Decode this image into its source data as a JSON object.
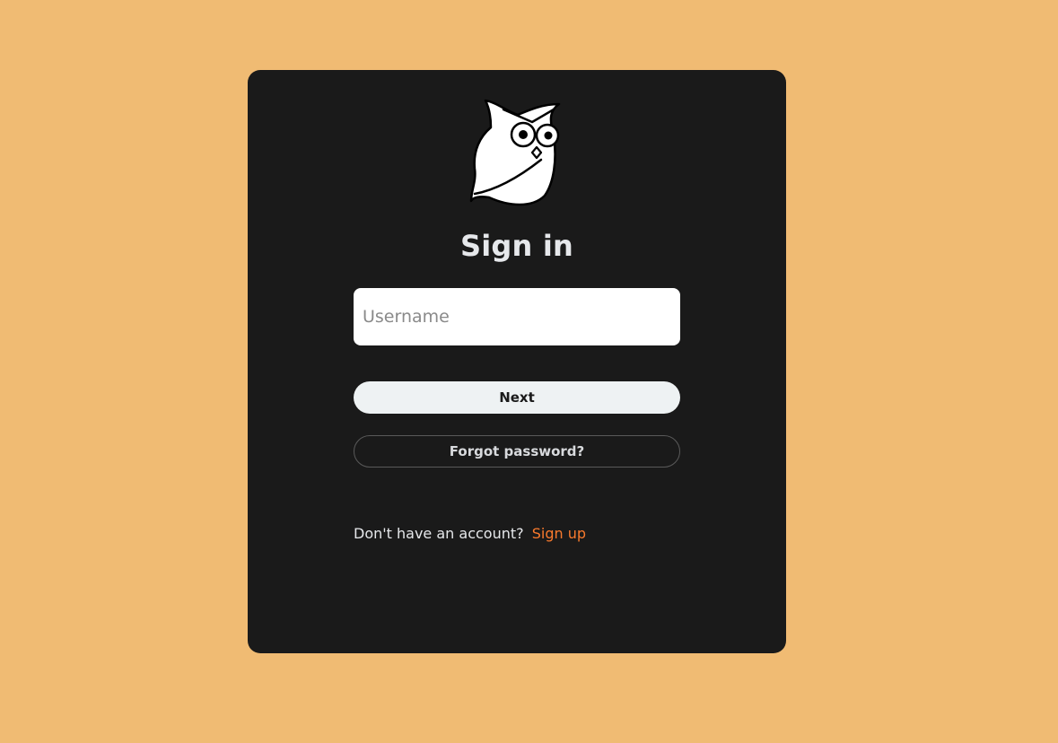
{
  "colors": {
    "background": "#F0BB73",
    "card": "#1A1A1A",
    "accent": "#F97A2D",
    "next_button": "#EEF2F3"
  },
  "logo": {
    "icon": "owl-logo-icon"
  },
  "signin": {
    "title": "Sign in",
    "username_placeholder": "Username",
    "username_value": "",
    "next_label": "Next",
    "forgot_label": "Forgot password?",
    "no_account_text": "Don't have an account?",
    "signup_label": "Sign up"
  }
}
